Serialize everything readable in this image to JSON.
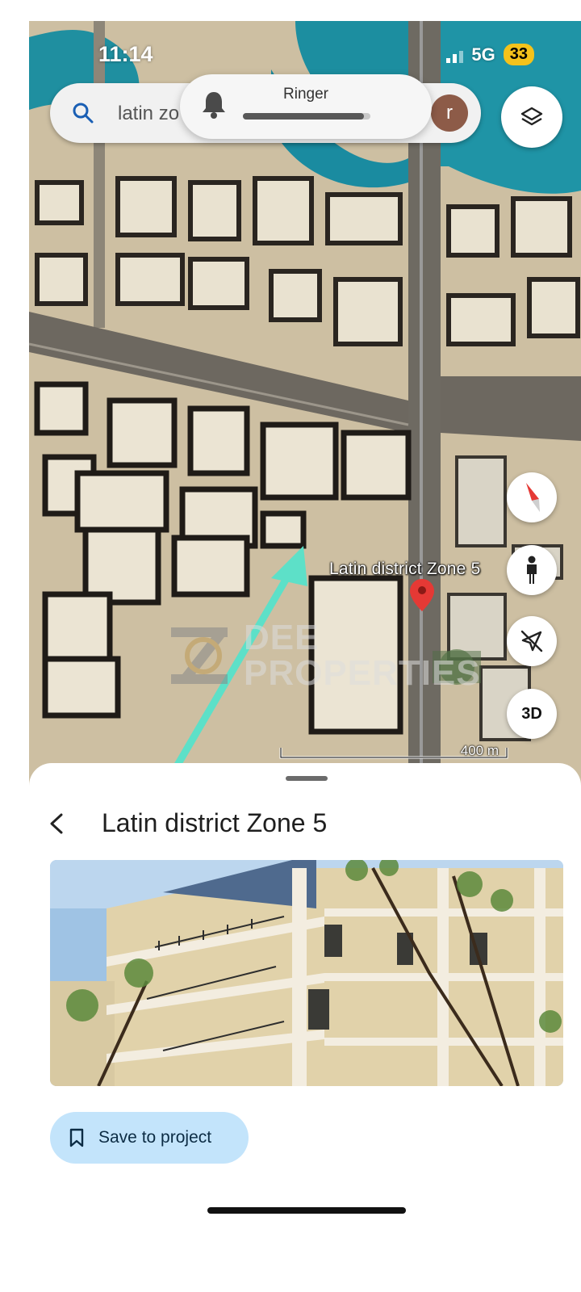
{
  "status_bar": {
    "time": "11:14",
    "network": "5G",
    "battery": "33"
  },
  "search": {
    "text": "latin zo",
    "avatar_initial": "r"
  },
  "ringer": {
    "label": "Ringer",
    "level": 0.95
  },
  "map": {
    "place_label": "Latin district Zone 5",
    "watermark": {
      "line1": "DEE",
      "line2": "PROPERTIES"
    },
    "scale_label": "400 m",
    "buttons": {
      "three_d": "3D"
    },
    "icons": [
      "layers-icon",
      "compass-icon",
      "pegman-icon",
      "location-off-icon",
      "map-pin-icon"
    ]
  },
  "sheet": {
    "title": "Latin district Zone 5",
    "save_label": "Save to project",
    "icons": [
      "back-arrow-icon",
      "bookmark-icon"
    ]
  },
  "colors": {
    "accent_pin": "#e53935",
    "save_button_bg": "#c3e4fb",
    "annotation_arrow": "#5de0c8",
    "water": "#1f8fa0"
  }
}
